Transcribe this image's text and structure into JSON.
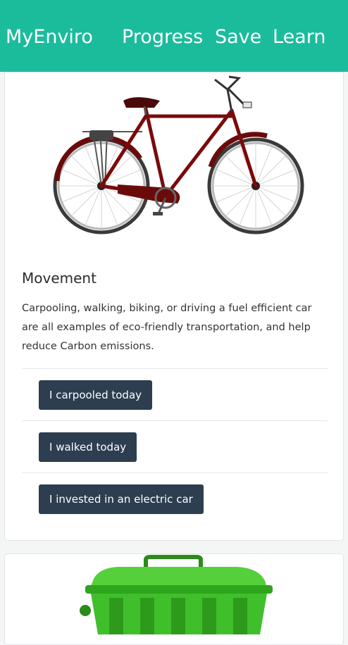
{
  "navbar": {
    "brand": "MyEnviro",
    "links": [
      "Progress",
      "Save",
      "Learn"
    ]
  },
  "movement_card": {
    "image_icon": "bicycle-image",
    "title": "Movement",
    "text": "Carpooling, walking, biking, or driving a fuel efficient car are all examples of eco-friendly transportation, and help reduce Carbon emissions.",
    "buttons": [
      "I carpooled today",
      "I walked today",
      "I invested in an electric car"
    ]
  },
  "next_card": {
    "image_icon": "recycling-bin-image"
  },
  "colors": {
    "navbar": "#1abc9c",
    "button": "#2c3e50",
    "bike_frame": "#7a0a0a",
    "bin": "#3fbf2a"
  }
}
